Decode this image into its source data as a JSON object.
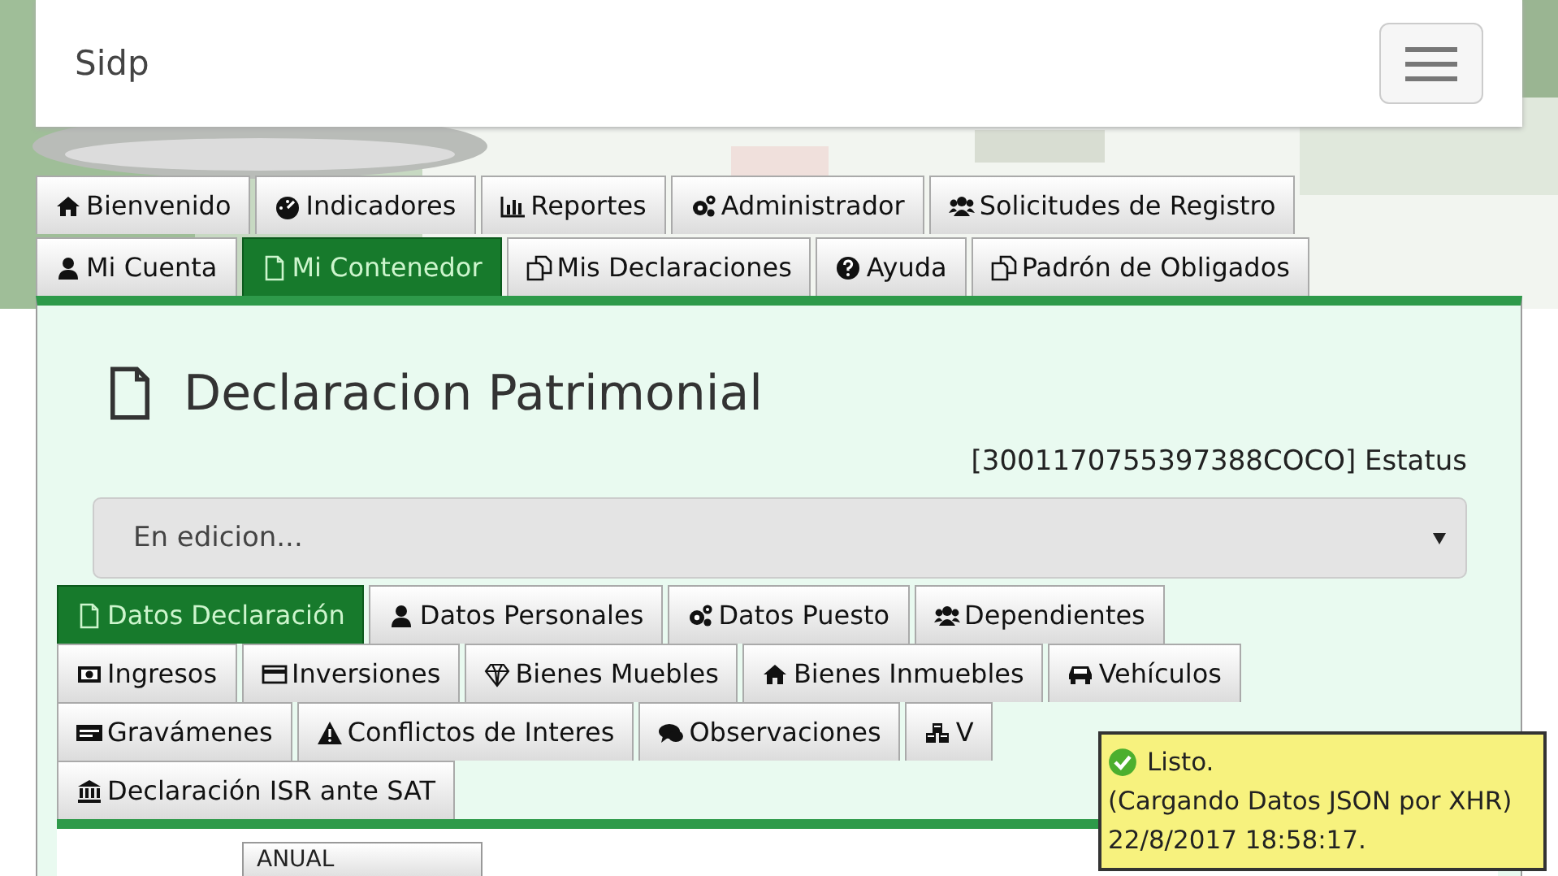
{
  "navbar": {
    "brand": "Sidp"
  },
  "nav_rows": [
    {
      "tabs": [
        {
          "label": "Bienvenido",
          "selected": false
        },
        {
          "label": "Indicadores",
          "selected": false
        },
        {
          "label": "Reportes",
          "selected": false
        },
        {
          "label": "Administrador",
          "selected": false
        },
        {
          "label": "Solicitudes de Registro",
          "selected": false
        }
      ]
    },
    {
      "tabs": [
        {
          "label": "Mi Cuenta",
          "selected": false
        },
        {
          "label": "Mi Contenedor",
          "selected": true
        },
        {
          "label": "Mis Declaraciones",
          "selected": false
        },
        {
          "label": "Ayuda",
          "selected": false
        },
        {
          "label": "Padrón de Obligados",
          "selected": false
        }
      ]
    }
  ],
  "panel": {
    "title": "Declaracion Patrimonial",
    "status_code": "[3001170755397388COCO] Estatus",
    "status_select": "En edicion..."
  },
  "sub_rows": [
    {
      "tabs": [
        {
          "label": "Datos Declaración",
          "selected": true
        },
        {
          "label": "Datos Personales",
          "selected": false
        },
        {
          "label": "Datos Puesto",
          "selected": false
        },
        {
          "label": "Dependientes",
          "selected": false
        }
      ]
    },
    {
      "tabs": [
        {
          "label": "Ingresos",
          "selected": false
        },
        {
          "label": "Inversiones",
          "selected": false
        },
        {
          "label": "Bienes Muebles",
          "selected": false
        },
        {
          "label": "Bienes Inmuebles",
          "selected": false
        },
        {
          "label": "Vehículos",
          "selected": false
        }
      ]
    },
    {
      "tabs": [
        {
          "label": "Gravámenes",
          "selected": false
        },
        {
          "label": "Conflictos de Interes",
          "selected": false
        },
        {
          "label": "Observaciones",
          "selected": false
        },
        {
          "label": "V",
          "selected": false
        }
      ]
    },
    {
      "tabs": [
        {
          "label": "Declaración ISR ante SAT",
          "selected": false
        }
      ]
    }
  ],
  "period_select": "ANUAL",
  "toast": {
    "lines": [
      "Listo.",
      "(Cargando Datos JSON por XHR)",
      "22/8/2017 18:58:17."
    ]
  }
}
